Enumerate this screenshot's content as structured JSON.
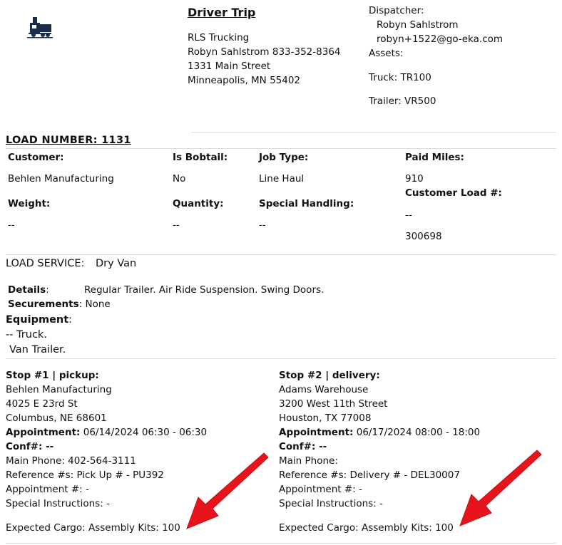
{
  "header": {
    "title": "Driver Trip",
    "company": "RLS Trucking",
    "contact": "Robyn Sahlstrom 833-352-8364",
    "street": "1331 Main Street",
    "city": "Minneapolis, MN 55402",
    "dispatcher_label": "Dispatcher:",
    "dispatcher_name": "Robyn Sahlstrom",
    "dispatcher_email": "robyn+1522@go-eka.com",
    "assets_label": "Assets:",
    "truck": "Truck: TR100",
    "trailer": "Trailer: VR500",
    "logo_icon": "truck-icon"
  },
  "load": {
    "number_label": "LOAD NUMBER: 1131",
    "customer_label": "Customer:",
    "customer": "Behlen Manufacturing",
    "bobtail_label": "Is Bobtail:",
    "bobtail": "No",
    "jobtype_label": "Job Type:",
    "jobtype": "Line Haul",
    "paidmiles_label": "Paid Miles:",
    "paidmiles": "910",
    "custload_label": "Customer Load #:",
    "custload_dash": "--",
    "custload": "300698",
    "weight_label": "Weight:",
    "weight": "--",
    "quantity_label": "Quantity:",
    "quantity": "--",
    "special_label": "Special Handling:",
    "special": "--"
  },
  "service": {
    "label": "LOAD SERVICE:",
    "value": "Dry Van",
    "details_label": "Details",
    "details": "Regular Trailer. Air Ride Suspension. Swing Doors.",
    "securements_label": "Securements",
    "securements": "None",
    "equipment_label": "Equipment",
    "equipment_line1": "-- Truck.",
    "equipment_line2": "Van Trailer."
  },
  "stops": [
    {
      "heading": "Stop #1 | pickup:",
      "name": "Behlen Manufacturing",
      "street": "4025 E 23rd St",
      "city": "Columbus, NE 68601",
      "appt_label": "Appointment:",
      "appt": "06/14/2024 06:30 - 06:30",
      "conf": "Conf#: --",
      "phone": "Main Phone: 402-564-3111",
      "refs": "Reference #s: Pick Up # - PU392",
      "appt_num": "Appointment #: -",
      "instructions": "Special Instructions: -",
      "cargo": "Expected Cargo: Assembly Kits: 100"
    },
    {
      "heading": "Stop #2 | delivery:",
      "name": "Adams Warehouse",
      "street": "3200 West 11th Street",
      "city": "Houston, TX 77008",
      "appt_label": "Appointment:",
      "appt": "06/17/2024 08:00 - 18:00",
      "conf": "Conf#: --",
      "phone": "Main Phone:",
      "refs": "Reference #s: Delivery # - DEL30007",
      "appt_num": "Appointment #: -",
      "instructions": "Special Instructions: -",
      "cargo": "Expected Cargo: Assembly Kits: 100"
    }
  ],
  "colors": {
    "arrow": "#e8141b",
    "divider": "#dcdcdc"
  }
}
